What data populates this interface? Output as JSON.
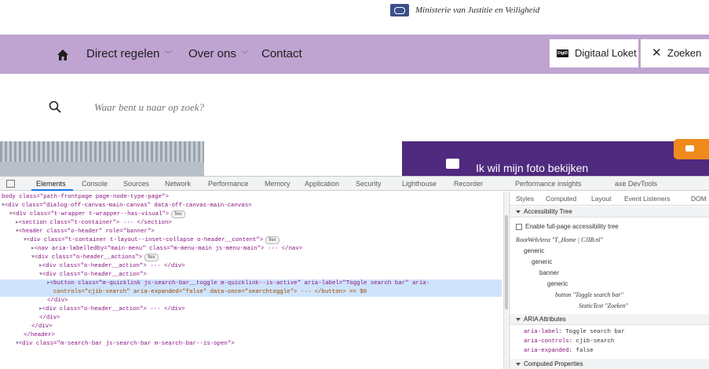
{
  "site": {
    "ministry": "Ministerie van Justitie en Veiligheid",
    "nav": {
      "items": [
        "Direct regelen",
        "Over ons",
        "Contact"
      ],
      "loket_badge": "DigiD",
      "loket_label": "Digitaal Loket",
      "search_toggle": "Zoeken"
    },
    "search": {
      "placeholder": "Waar bent u naar op zoek?"
    },
    "hero": {
      "text": "Ik wil mijn foto bekijken"
    },
    "colors": {
      "nav": "#bfa3d1",
      "hero": "#4f2a7e",
      "chat": "#f08a1c"
    }
  },
  "devtools": {
    "tabs": [
      "Elements",
      "Console",
      "Sources",
      "Network",
      "Performance",
      "Memory",
      "Application",
      "Security",
      "Lighthouse",
      "Recorder",
      "Performance insights",
      "axe DevTools"
    ],
    "side_tabs": [
      "Styles",
      "Computed",
      "Layout",
      "Event Listeners",
      "DOM"
    ],
    "accessibility_tree": {
      "title": "Accessibility Tree",
      "enable_label": "Enable full-page accessibility tree",
      "nodes": [
        "RootWebArea \"T_Home | CJIB.nl\"",
        "generic",
        "generic",
        "banner",
        "generic",
        "button \"Toggle search bar\"",
        "StaticText \"Zoeken\""
      ]
    },
    "aria": {
      "title": "ARIA Attributes",
      "attrs": [
        {
          "key": "aria-label",
          "value": "Toggle search bar"
        },
        {
          "key": "aria-controls",
          "value": "cjib-search"
        },
        {
          "key": "aria-expanded",
          "value": "false"
        }
      ]
    },
    "computed_title": "Computed Properties",
    "dom_lines": [
      "body class=\"path-frontpage page-node-type-page\">",
      "<div class=\"dialog-off-canvas-main-canvas\" data-off-canvas-main-canvas>",
      "<div class=\"t-wrapper t-wrapper--has-visual\">",
      "<section class=\"t-container\"> ··· </section>",
      "<header class=\"o-header\" role=\"banner\">",
      "<div class=\"t-container t-layout--inset-collapse o-header__content\">",
      "<nav aria-labelledby=\"main-menu\" class=\"m-menu-main js-menu-main\"> ··· </nav>",
      "<div class=\"o-header__actions\">",
      "<div class=\"o-header__action\"> ··· </div>",
      "<div class=\"o-header__action\">",
      "<button class=\"m-quicklink js-search-bar__toggle m-quicklink--is-active\" aria-label=\"Toggle search bar\" aria-",
      "controls=\"cjib-search\" aria-expanded=\"false\" data-once=\"searchtoggle\"> ··· </button> == $0",
      "</div>",
      "<div class=\"o-header__action\"> ··· </div>",
      "</div>",
      "</div>",
      "</header>",
      "<div class=\"m-search-bar js-search-bar m-search-bar--is-open\">"
    ],
    "badges": {
      "flex": "flex"
    }
  }
}
